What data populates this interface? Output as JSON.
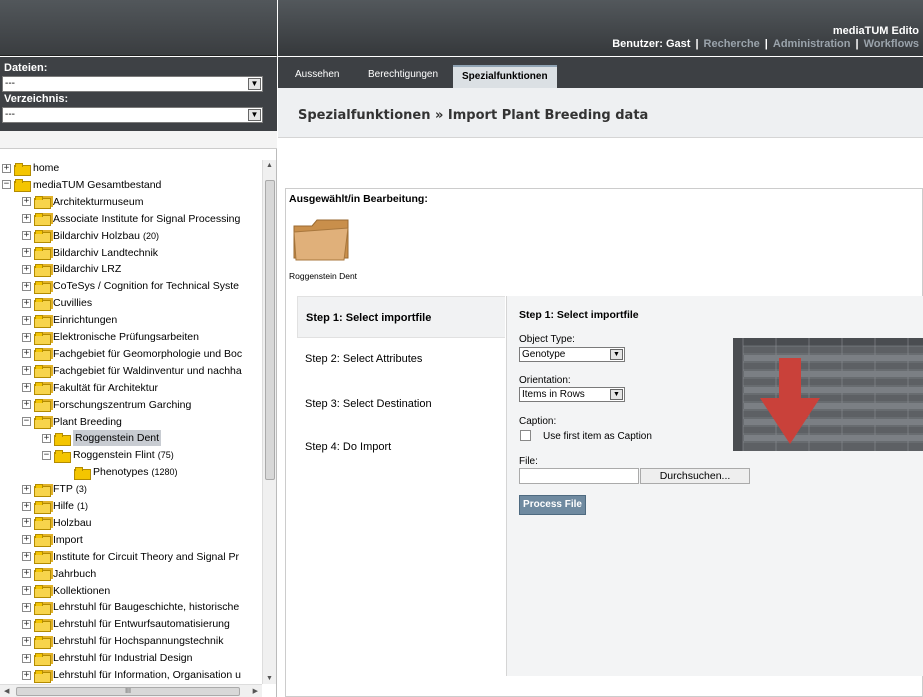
{
  "sidebar": {
    "files_label": "Dateien:",
    "files_value": "---",
    "directory_label": "Verzeichnis:",
    "directory_value": "---",
    "tree": [
      {
        "label": "home",
        "level": 0,
        "toggle": "+",
        "icon": "folder-icon"
      },
      {
        "label": "mediaTUM Gesamtbestand",
        "level": 0,
        "toggle": "-",
        "icon": "folder-icon"
      },
      {
        "label": "Architekturmuseum",
        "level": 1,
        "toggle": "+",
        "icon": "collection-icon"
      },
      {
        "label": "Associate Institute for Signal Processing",
        "level": 1,
        "toggle": "+",
        "icon": "collection-icon"
      },
      {
        "label": "Bildarchiv Holzbau",
        "count": "(20)",
        "level": 1,
        "toggle": "+",
        "icon": "collection-icon"
      },
      {
        "label": "Bildarchiv Landtechnik",
        "level": 1,
        "toggle": "+",
        "icon": "collection-icon"
      },
      {
        "label": "Bildarchiv LRZ",
        "level": 1,
        "toggle": "+",
        "icon": "collection-icon"
      },
      {
        "label": "CoTeSys / Cognition for Technical Syste",
        "level": 1,
        "toggle": "+",
        "icon": "collection-icon"
      },
      {
        "label": "Cuvillies",
        "level": 1,
        "toggle": "+",
        "icon": "collection-icon"
      },
      {
        "label": "Einrichtungen",
        "level": 1,
        "toggle": "+",
        "icon": "collection-icon"
      },
      {
        "label": "Elektronische Prüfungsarbeiten",
        "level": 1,
        "toggle": "+",
        "icon": "collection-icon"
      },
      {
        "label": "Fachgebiet für Geomorphologie und Boc",
        "level": 1,
        "toggle": "+",
        "icon": "collection-icon"
      },
      {
        "label": "Fachgebiet für Waldinventur und nachha",
        "level": 1,
        "toggle": "+",
        "icon": "collection-icon"
      },
      {
        "label": "Fakultät für Architektur",
        "level": 1,
        "toggle": "+",
        "icon": "collection-icon"
      },
      {
        "label": "Forschungszentrum Garching",
        "level": 1,
        "toggle": "+",
        "icon": "collection-icon"
      },
      {
        "label": "Plant Breeding",
        "level": 1,
        "toggle": "-",
        "icon": "collection-icon"
      },
      {
        "label": "Roggenstein Dent",
        "level": 2,
        "toggle": "+",
        "icon": "folder-icon",
        "selected": true
      },
      {
        "label": "Roggenstein Flint",
        "count": "(75)",
        "level": 2,
        "toggle": "-",
        "icon": "folder-icon"
      },
      {
        "label": "Phenotypes",
        "count": "(1280)",
        "level": 3,
        "toggle": "",
        "icon": "folder-icon"
      },
      {
        "label": "FTP",
        "count": "(3)",
        "level": 1,
        "toggle": "+",
        "icon": "collection-icon"
      },
      {
        "label": "Hilfe",
        "count": "(1)",
        "level": 1,
        "toggle": "+",
        "icon": "collection-icon"
      },
      {
        "label": "Holzbau",
        "level": 1,
        "toggle": "+",
        "icon": "collection-icon"
      },
      {
        "label": "Import",
        "level": 1,
        "toggle": "+",
        "icon": "collection-icon"
      },
      {
        "label": "Institute for Circuit Theory and Signal Pr",
        "level": 1,
        "toggle": "+",
        "icon": "collection-icon"
      },
      {
        "label": "Jahrbuch",
        "level": 1,
        "toggle": "+",
        "icon": "collection-icon"
      },
      {
        "label": "Kollektionen",
        "level": 1,
        "toggle": "+",
        "icon": "collection-icon"
      },
      {
        "label": "Lehrstuhl für Baugeschichte, historische",
        "level": 1,
        "toggle": "+",
        "icon": "collection-icon"
      },
      {
        "label": "Lehrstuhl für Entwurfsautomatisierung",
        "level": 1,
        "toggle": "+",
        "icon": "collection-icon"
      },
      {
        "label": "Lehrstuhl für Hochspannungstechnik",
        "level": 1,
        "toggle": "+",
        "icon": "collection-icon"
      },
      {
        "label": "Lehrstuhl für Industrial Design",
        "level": 1,
        "toggle": "+",
        "icon": "collection-icon"
      },
      {
        "label": "Lehrstuhl für Information, Organisation u",
        "level": 1,
        "toggle": "+",
        "icon": "collection-icon"
      }
    ]
  },
  "header": {
    "app_title": "mediaTUM Edito",
    "user_label": "Benutzer: Gast",
    "nav": [
      "Recherche",
      "Administration",
      "Workflows"
    ]
  },
  "tabs": [
    "Aussehen",
    "Berechtigungen",
    "Spezialfunktionen"
  ],
  "active_tab": "Spezialfunktionen",
  "breadcrumb": "Spezialfunktionen » Import Plant Breeding data",
  "selection": {
    "label": "Ausgewählt/in Bearbeitung:",
    "item_name": "Roggenstein Dent"
  },
  "wizard": {
    "steps": [
      "Step 1: Select importfile",
      "Step 2: Select Attributes",
      "Step 3: Select Destination",
      "Step 4: Do Import"
    ],
    "active_step": 0,
    "panel_title": "Step 1: Select importfile",
    "object_type_label": "Object Type:",
    "object_type_value": "Genotype",
    "orientation_label": "Orientation:",
    "orientation_value": "Items in Rows",
    "caption_label": "Caption:",
    "caption_checkbox_label": "Use first item as Caption",
    "caption_checked": false,
    "file_label": "File:",
    "file_value": "",
    "browse_label": "Durchsuchen...",
    "process_label": "Process File"
  },
  "colors": {
    "header_bg": "#3d4044",
    "active_tab_bg": "#dbe0e4",
    "process_button": "#6f8aa0",
    "arrow_red": "#c9413a",
    "folder_yellow": "#f4c500"
  }
}
